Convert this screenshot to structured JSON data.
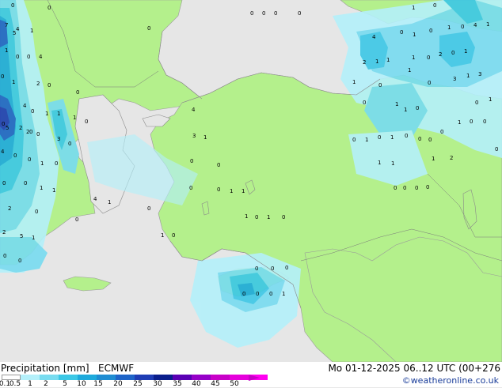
{
  "map": {
    "precip_labels": [
      "0",
      "0",
      "0",
      "0",
      "0",
      "0",
      "1",
      "0",
      "7",
      "4",
      "5",
      "1",
      "0",
      "4",
      "0",
      "1",
      "0",
      "1",
      "0",
      "4",
      "1",
      "1",
      "0",
      "0",
      "4",
      "2",
      "1",
      "1",
      "1",
      "0",
      "2",
      "0",
      "1",
      "0",
      "1",
      "2",
      "0",
      "1",
      "0",
      "1",
      "0",
      "3",
      "1",
      "3",
      "0",
      "4",
      "0",
      "0",
      "1",
      "1",
      "0",
      "1",
      "0",
      "0",
      "2",
      "0",
      "1",
      "1",
      "1",
      "0",
      "5",
      "2",
      "0",
      "3",
      "4",
      "0",
      "0",
      "1",
      "0",
      "0",
      "4",
      "3",
      "1",
      "0",
      "1",
      "0",
      "1",
      "0",
      "0",
      "0",
      "0",
      "1",
      "0",
      "0",
      "0",
      "0",
      "1",
      "1",
      "0",
      "0",
      "1",
      "1",
      "1",
      "2",
      "0",
      "0",
      "0",
      "1",
      "1",
      "0",
      "0",
      "0",
      "0",
      "2",
      "0",
      "0",
      "4",
      "1",
      "0",
      "2",
      "5",
      "1",
      "1",
      "0",
      "1",
      "0",
      "1",
      "0",
      "0",
      "0",
      "0",
      "0",
      "0",
      "0",
      "0",
      "0",
      "1",
      "0"
    ]
  },
  "legend": {
    "title": "Precipitation [mm]",
    "model": "ECMWF",
    "datetime": "Mo 01-12-2025 06..12 UTC (00+276",
    "credit": "©weatheronline.co.uk",
    "colors": [
      "#ffffff",
      "#b4f0fa",
      "#78dcf0",
      "#3cc8e6",
      "#1eaadc",
      "#1e8cd2",
      "#1e64c8",
      "#1e3cb4",
      "#0a1e8c",
      "#5a00b4",
      "#9600c8",
      "#c800c8",
      "#e600dc",
      "#ff00f0"
    ],
    "ticks": [
      "0.1",
      "0.5",
      "1",
      "2",
      "5",
      "10",
      "15",
      "20",
      "25",
      "30",
      "35",
      "40",
      "45",
      "50"
    ],
    "arrow_color": "#c800c8"
  }
}
